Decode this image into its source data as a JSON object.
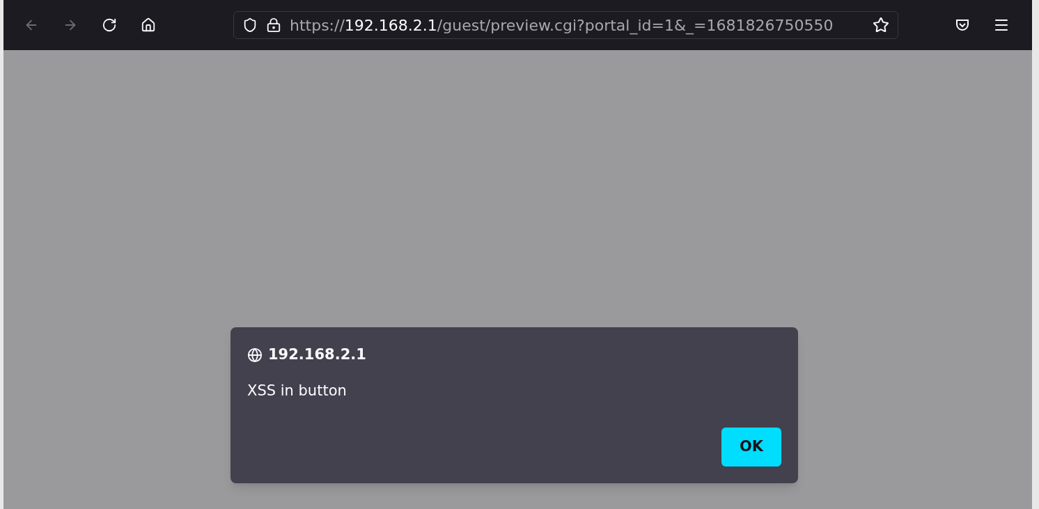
{
  "toolbar": {
    "buttons": [
      {
        "kind": "back",
        "disabled": true
      },
      {
        "kind": "forward",
        "disabled": true
      },
      {
        "kind": "reload",
        "disabled": false
      },
      {
        "kind": "home",
        "disabled": false
      }
    ]
  },
  "address_bar": {
    "url_prefix": "https://",
    "url_host": "192.168.2.1",
    "url_rest": "/guest/preview.cgi?portal_id=1&_=1681826750550"
  },
  "dialog": {
    "origin": "192.168.2.1",
    "message": "XSS in button",
    "button": "OK"
  }
}
